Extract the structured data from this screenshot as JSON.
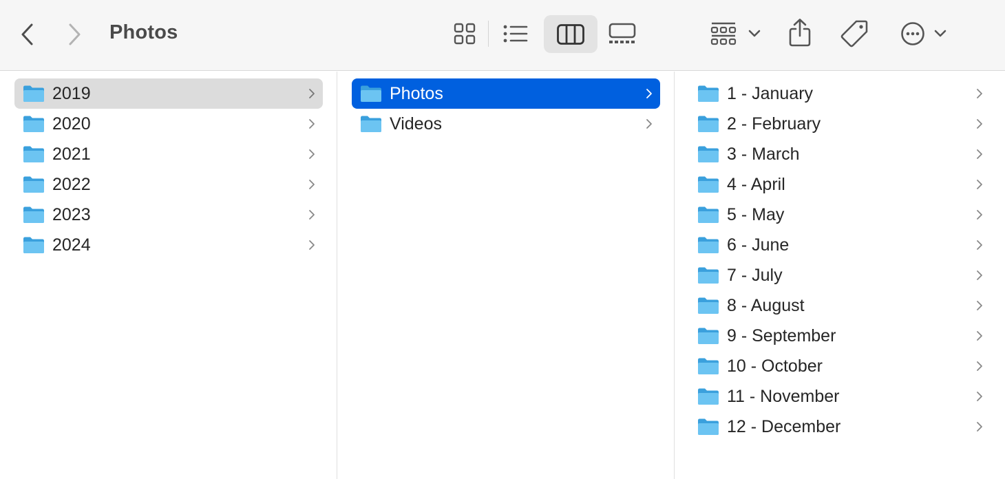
{
  "toolbar": {
    "title": "Photos",
    "back_icon": "chevron-left-icon",
    "forward_icon": "chevron-right-icon",
    "view_modes": [
      "icon-view-icon",
      "list-view-icon",
      "column-view-icon",
      "gallery-view-icon"
    ],
    "active_view": "column-view-icon",
    "group_icon": "group-by-icon",
    "share_icon": "share-icon",
    "tag_icon": "tag-icon",
    "more_icon": "more-actions-icon"
  },
  "colors": {
    "selection_blue": "#0060df",
    "selection_gray": "#dcdcdc",
    "folder_blue": "#5ab9ec"
  },
  "columns": {
    "years": {
      "selected": "2019",
      "items": [
        {
          "label": "2019"
        },
        {
          "label": "2020"
        },
        {
          "label": "2021"
        },
        {
          "label": "2022"
        },
        {
          "label": "2023"
        },
        {
          "label": "2024"
        }
      ]
    },
    "media": {
      "selected": "Photos",
      "items": [
        {
          "label": "Photos"
        },
        {
          "label": "Videos"
        }
      ]
    },
    "months": {
      "items": [
        {
          "label": "1 - January"
        },
        {
          "label": "2 - February"
        },
        {
          "label": "3 - March"
        },
        {
          "label": "4 - April"
        },
        {
          "label": "5 - May"
        },
        {
          "label": "6 - June"
        },
        {
          "label": "7 - July"
        },
        {
          "label": "8 - August"
        },
        {
          "label": "9 - September"
        },
        {
          "label": "10 - October"
        },
        {
          "label": "11 - November"
        },
        {
          "label": "12 - December"
        }
      ]
    }
  }
}
